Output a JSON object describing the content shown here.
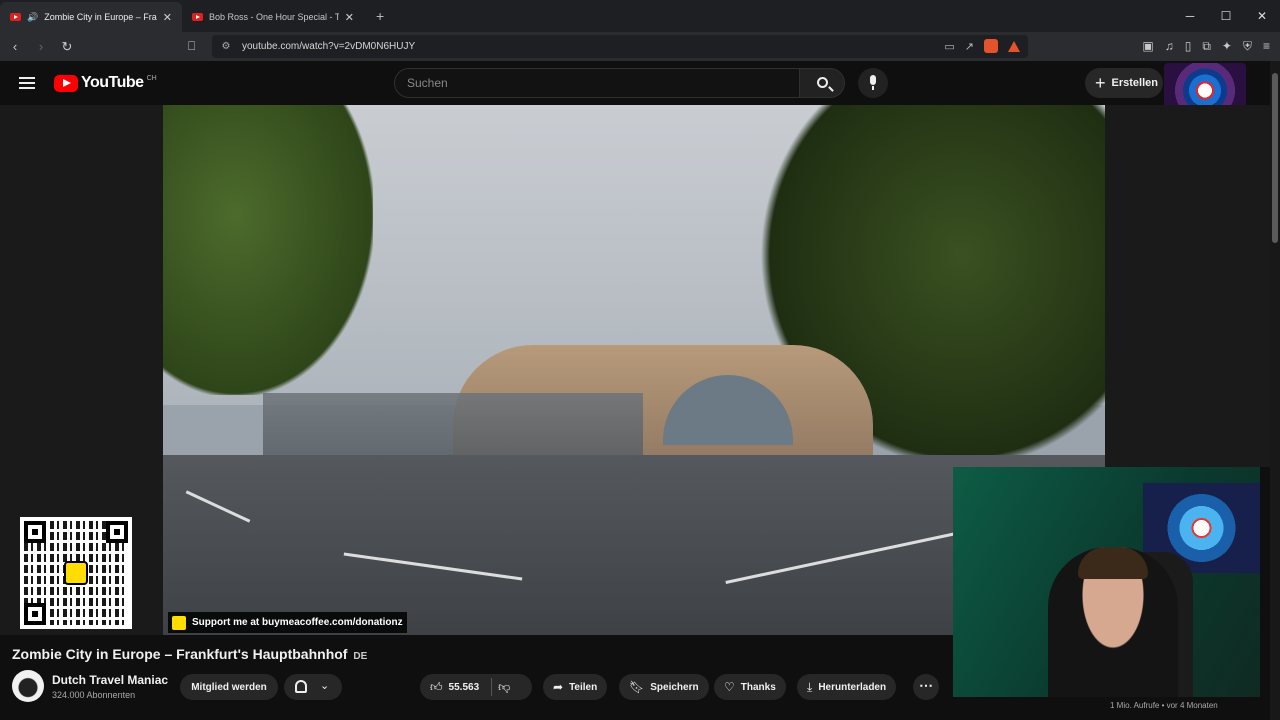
{
  "browser": {
    "tabs": [
      {
        "title": "Zombie City in Europe – Fran",
        "active": true
      },
      {
        "title": "Bob Ross - One Hour Special - The G",
        "active": false
      }
    ],
    "url": "youtube.com/watch?v=2vDM0N6HUJY"
  },
  "youtube": {
    "region": "CH",
    "logo_text": "YouTube",
    "search_placeholder": "Suchen",
    "create_label": "Erstellen"
  },
  "video": {
    "overlay_text": "Support me at buymeacoffee.com/donationz",
    "title": "Zombie City in Europe – Frankfurt's Hauptbahnhof",
    "title_lang": "DE",
    "channel_name": "Dutch Travel Maniac",
    "channel_subs": "324.000 Abonnenten",
    "member_label": "Mitglied werden",
    "likes": "55.563",
    "share_label": "Teilen",
    "save_label": "Speichern",
    "thanks_label": "Thanks",
    "download_label": "Herunterladen",
    "views_meta": "1 Mio. Aufrufe • vor 4 Monaten"
  },
  "colors": {
    "background": "#0f0f0f",
    "youtube_red": "#ff0000",
    "pill": "#272727"
  }
}
